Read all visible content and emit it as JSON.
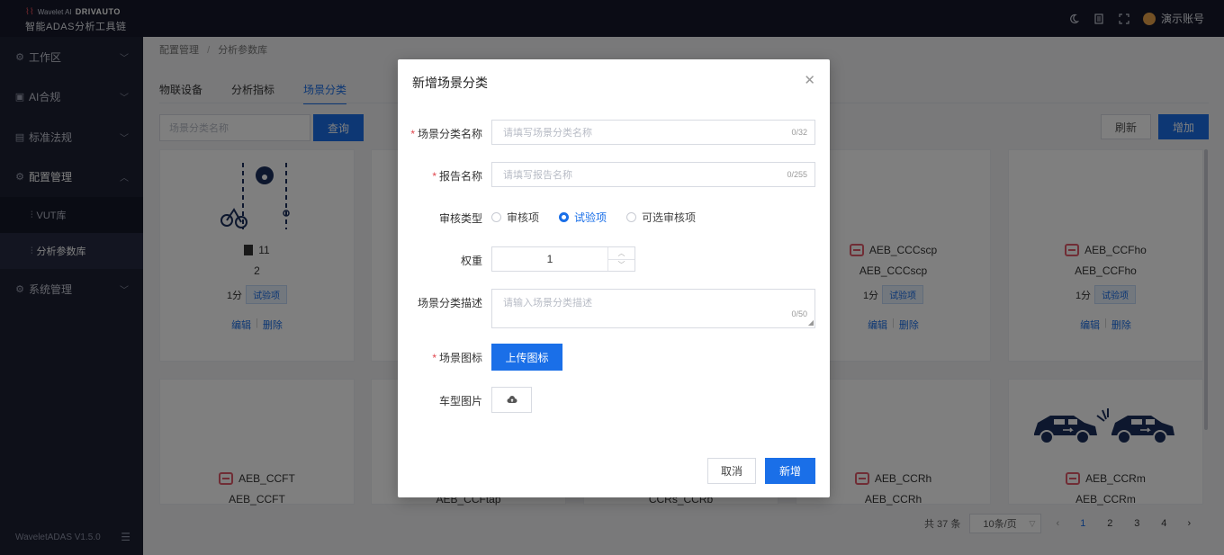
{
  "header": {
    "brand_line1": "Wavelet AI",
    "brand_partner": "DRIVAUTO",
    "brand_title": "智能ADAS分析工具链",
    "user_name": "演示账号",
    "icons": [
      "moon-icon",
      "document-icon",
      "fullscreen-icon",
      "user-avatar"
    ]
  },
  "sidebar": {
    "items": [
      {
        "label": "工作区",
        "icon": "gear-icon"
      },
      {
        "label": "AI合规",
        "icon": "ai-icon"
      },
      {
        "label": "标准法规",
        "icon": "book-icon"
      },
      {
        "label": "配置管理",
        "icon": "gear-icon"
      },
      {
        "label": "系统管理",
        "icon": "gear-icon"
      }
    ],
    "sub_items": [
      {
        "label": "VUT库",
        "icon": "sliders-icon"
      },
      {
        "label": "分析参数库",
        "icon": "sliders-icon"
      }
    ],
    "footer": "WaveletADAS  V1.5.0"
  },
  "main": {
    "breadcrumb": [
      "配置管理",
      "分析参数库"
    ],
    "tabs": [
      "物联设备",
      "分析指标",
      "场景分类"
    ],
    "search_placeholder": "场景分类名称",
    "query_label": "查询",
    "refresh_label": "刷新",
    "add_label": "增加",
    "edit_label": "编辑",
    "delete_label": "删除",
    "cards": [
      {
        "title": "11",
        "subtitle": "2",
        "score": "1分",
        "tag": "试验项"
      },
      {
        "title": "AEB_CCCscp",
        "subtitle": "AEB_CCCscp",
        "score": "1分",
        "tag": "试验项"
      },
      {
        "title": "AEB_CCFho",
        "subtitle": "AEB_CCFho",
        "score": "1分",
        "tag": "试验项"
      },
      {
        "title": "AEB_CCFT",
        "subtitle": "AEB_CCFT"
      },
      {
        "title": "",
        "subtitle": "AEB_CCFtap"
      },
      {
        "title": "",
        "subtitle": "CCRs_CCRb"
      },
      {
        "title": "AEB_CCRh",
        "subtitle": "AEB_CCRh"
      },
      {
        "title": "AEB_CCRm",
        "subtitle": "AEB_CCRm"
      }
    ],
    "pagination": {
      "total": "共 37 条",
      "page_size": "10条/页",
      "pages": [
        "1",
        "2",
        "3",
        "4"
      ],
      "current": "1"
    }
  },
  "modal": {
    "title": "新增场景分类",
    "fields": {
      "name_label": "场景分类名称",
      "name_placeholder": "请填写场景分类名称",
      "name_count": "0/32",
      "report_label": "报告名称",
      "report_placeholder": "请填写报告名称",
      "report_count": "0/255",
      "type_label": "审核类型",
      "type_options": [
        "审核项",
        "试验项",
        "可选审核项"
      ],
      "type_selected": "试验项",
      "weight_label": "权重",
      "weight_value": "1",
      "desc_label": "场景分类描述",
      "desc_placeholder": "请输入场景分类描述",
      "desc_count": "0/50",
      "icon_label": "场景图标",
      "upload_label": "上传图标",
      "car_label": "车型图片"
    },
    "cancel_label": "取消",
    "submit_label": "新增"
  },
  "colors": {
    "primary": "#1a6fe8",
    "sidebar_bg": "#1c2033",
    "header_bg": "#16192a",
    "required": "#e0464e"
  }
}
